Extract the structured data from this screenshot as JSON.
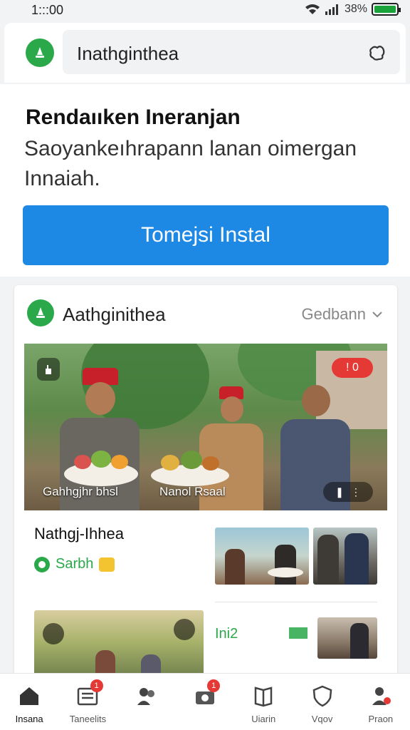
{
  "status": {
    "time": "1:::00",
    "battery": "38%",
    "battery_level": 0.38
  },
  "header": {
    "app_name": "Inathginthea",
    "icon": "puzzle-icon"
  },
  "hero": {
    "title": "Rendaııken Ineranjan",
    "subtitle": "Saoyankeıhrapann lanan oimergan Innaiah.",
    "install_label": "Tomejsi Instal"
  },
  "card": {
    "title": "Aathginithea",
    "dropdown": "Gedbann",
    "photo_caption_left": "Gahhgjhr bhsl",
    "photo_caption_right": "Nanol Rsaal",
    "photo_badge": "! 0",
    "subtitle": "Nathgj-Ihhea",
    "user": "Sarbh",
    "info": "Ini2"
  },
  "bottom_nav": {
    "items": [
      {
        "label": "Insana",
        "icon": "home-icon"
      },
      {
        "label": "Taneelits",
        "icon": "news-icon",
        "badge": "1"
      },
      {
        "label": "",
        "icon": "people-icon"
      },
      {
        "label": "",
        "icon": "camera-icon",
        "badge": "1"
      },
      {
        "label": "Uiarin",
        "icon": "book-icon"
      },
      {
        "label": "Vqov",
        "icon": "shield-icon"
      },
      {
        "label": "Praon",
        "icon": "profile-icon"
      }
    ]
  },
  "colors": {
    "accent": "#1e88e5",
    "brand_green": "#2aa84a",
    "badge_red": "#e53935"
  }
}
